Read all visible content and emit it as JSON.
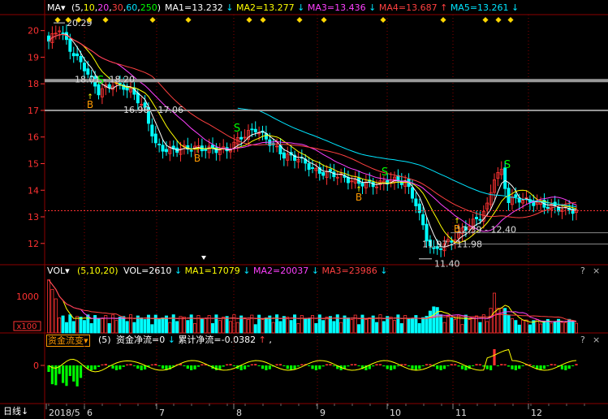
{
  "price_header": {
    "indicator": "MA",
    "params_open": "(",
    "params": [
      {
        "text": "5",
        "color": "#ffffff"
      },
      {
        "text": "10",
        "color": "#ffff00"
      },
      {
        "text": "20",
        "color": "#ff40ff"
      },
      {
        "text": "30",
        "color": "#ff4040"
      },
      {
        "text": "60",
        "color": "#00e5ff"
      },
      {
        "text": "250",
        "color": "#00ff00"
      }
    ],
    "params_close": ")",
    "values": [
      {
        "label": "MA1=13.232",
        "arrow": "↓",
        "color": "#ffffff",
        "arrow_color": "#00e5ff"
      },
      {
        "label": "MA2=13.277",
        "arrow": "↓",
        "color": "#ffff00",
        "arrow_color": "#00e5ff"
      },
      {
        "label": "MA3=13.436",
        "arrow": "↓",
        "color": "#ff40ff",
        "arrow_color": "#00e5ff"
      },
      {
        "label": "MA4=13.687",
        "arrow": "↑",
        "color": "#ff4040",
        "arrow_color": "#ff4040"
      },
      {
        "label": "MA5=13.261",
        "arrow": "↓",
        "color": "#00e5ff",
        "arrow_color": "#00e5ff"
      }
    ]
  },
  "price_axis": {
    "labels": [
      "20",
      "19",
      "18",
      "17",
      "16",
      "15",
      "14",
      "13",
      "12"
    ],
    "ylim": [
      11.2,
      20.6
    ]
  },
  "annotations": {
    "high": "20.29",
    "band1": "18.01 - 18.20",
    "band2": "16.96 - 17.06",
    "band3": "12.39 - 12.40",
    "band4": "11.97 - 11.98",
    "low": "11.40",
    "buy_marker": "B",
    "sell_marker": "S",
    "buy_color": "#ff9900",
    "sell_color": "#00ff00"
  },
  "volume_header": {
    "indicator": "VOL",
    "params": "(5,10,20)",
    "values": [
      {
        "label": "VOL=2610",
        "arrow": "↓",
        "color": "#ffffff",
        "arrow_color": "#00e5ff"
      },
      {
        "label": "MA1=17079",
        "arrow": "↓",
        "color": "#ffff00",
        "arrow_color": "#00e5ff"
      },
      {
        "label": "MA2=20037",
        "arrow": "↓",
        "color": "#ff40ff",
        "arrow_color": "#00e5ff"
      },
      {
        "label": "MA3=23986",
        "arrow": "↓",
        "color": "#ff4040",
        "arrow_color": "#00e5ff"
      }
    ]
  },
  "volume_axis": {
    "labels": [
      "1000",
      "x100"
    ]
  },
  "flow_header": {
    "indicator": "资金流变",
    "param": "(5)",
    "values": [
      {
        "label": "资金净流=0",
        "arrow": "↓",
        "color": "#ffffff",
        "arrow_color": "#00e5ff"
      },
      {
        "label": "累计净流=-0.0382",
        "arrow": "↑",
        "color": "#ffffff",
        "arrow_color": "#ff4040"
      }
    ],
    "trailing": ","
  },
  "flow_axis": {
    "labels": [
      "0"
    ]
  },
  "panel_buttons": [
    "?",
    "×"
  ],
  "period": {
    "label": "日线",
    "arrow": "↓"
  },
  "date_axis": {
    "labels": [
      "2018/5",
      "6",
      "7",
      "8",
      "9",
      "10",
      "11",
      "12"
    ]
  },
  "colors": {
    "up": "#ff3232",
    "down": "#00ffff",
    "background": "#000000",
    "grid": "#8b0000"
  }
}
